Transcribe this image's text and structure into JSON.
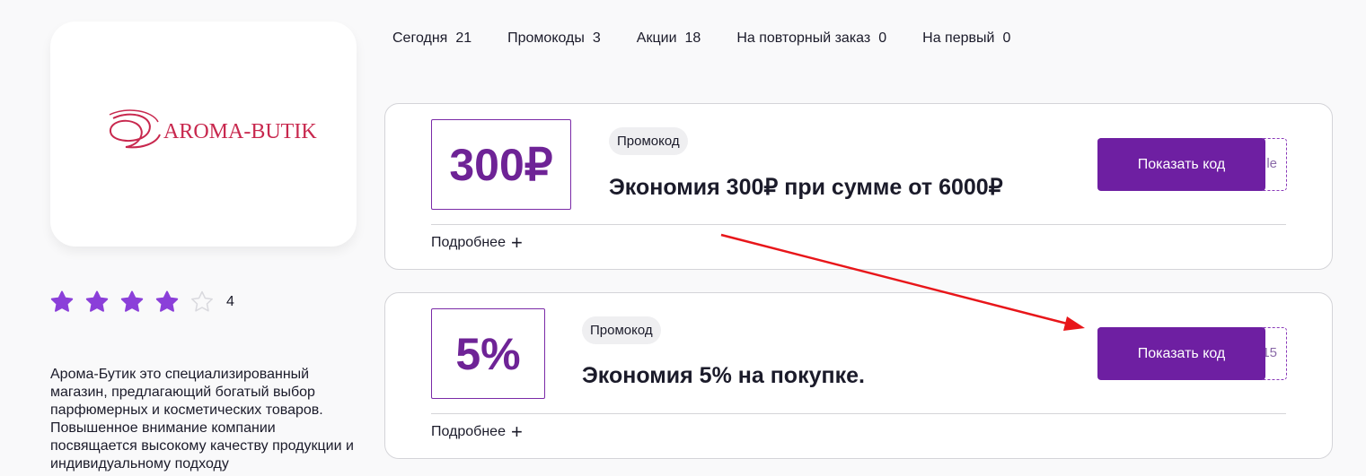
{
  "store": {
    "logo_text": "AROMA-BUTIK",
    "rating_value": "4",
    "rating_stars": 4,
    "rating_max": 5,
    "description": "Арома-Бутик это специализированный магазин, предлагающий богатый выбор парфюмерных и косметических товаров. Повышенное внимание компании посвящается высокому качеству продукции и индивидуальному подходу"
  },
  "tabs": [
    {
      "label": "Сегодня",
      "count": "21"
    },
    {
      "label": "Промокоды",
      "count": "3"
    },
    {
      "label": "Акции",
      "count": "18"
    },
    {
      "label": "На повторный заказ",
      "count": "0"
    },
    {
      "label": "На первый",
      "count": "0"
    }
  ],
  "offers": [
    {
      "value": "300₽",
      "badge": "Промокод",
      "title": "Экономия 300₽ при сумме от 6000₽",
      "code_peek": "le",
      "button": "Показать код",
      "more": "Подробнее"
    },
    {
      "value": "5%",
      "badge": "Промокод",
      "title": "Экономия 5% на покупке.",
      "code_peek": "15",
      "button": "Показать код",
      "more": "Подробнее"
    }
  ],
  "colors": {
    "accent": "#6e1fa2",
    "star": "#8b3fd9",
    "star_empty": "#d9d9de",
    "logo": "#c8284e",
    "annotation_arrow": "#e8161a"
  },
  "icons": {
    "star": "star-icon",
    "plus": "plus-icon",
    "arrow": "annotation-arrow"
  }
}
